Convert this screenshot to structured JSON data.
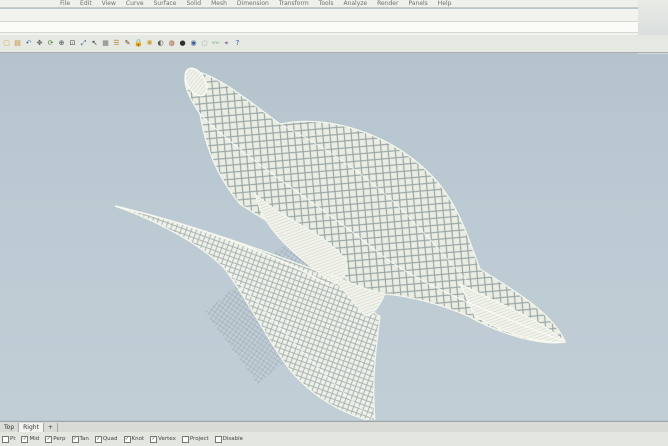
{
  "app": {
    "menu": [
      "File",
      "Edit",
      "View",
      "Curve",
      "Surface",
      "Solid",
      "Mesh",
      "Dimension",
      "Transform",
      "Tools",
      "Analyze",
      "Render",
      "Panels",
      "Help"
    ]
  },
  "toolbar": {
    "icons": [
      "new-file-icon",
      "open-icon",
      "undo-icon",
      "pan-icon",
      "rotate-icon",
      "zoom-icon",
      "zoom-window-icon",
      "zoom-extents-icon",
      "select-icon",
      "grid-icon",
      "layer-icon",
      "properties-icon",
      "lock-icon",
      "light-icon",
      "render-icon",
      "material-icon",
      "shade-icon",
      "sphere-icon",
      "ghost-icon",
      "curve-icon",
      "analyze-icon",
      "help-icon"
    ]
  },
  "tabs": [
    {
      "label": "Top"
    },
    {
      "label": "Right",
      "active": true
    },
    {
      "label": "+"
    }
  ],
  "statusbar": {
    "snaps": [
      {
        "label": "Pt",
        "checked": false
      },
      {
        "label": "Mid",
        "checked": true
      },
      {
        "label": "Perp",
        "checked": true
      },
      {
        "label": "Tan",
        "checked": true
      },
      {
        "label": "Quad",
        "checked": true
      },
      {
        "label": "Knot",
        "checked": true
      },
      {
        "label": "Vertex",
        "checked": true
      },
      {
        "label": "Project",
        "checked": false
      },
      {
        "label": "Disable",
        "checked": false
      }
    ]
  },
  "viewport": {
    "background": "#bccad3",
    "wireframe_color": "#f4f6ec",
    "object": "lattice-surface-sculpture"
  }
}
